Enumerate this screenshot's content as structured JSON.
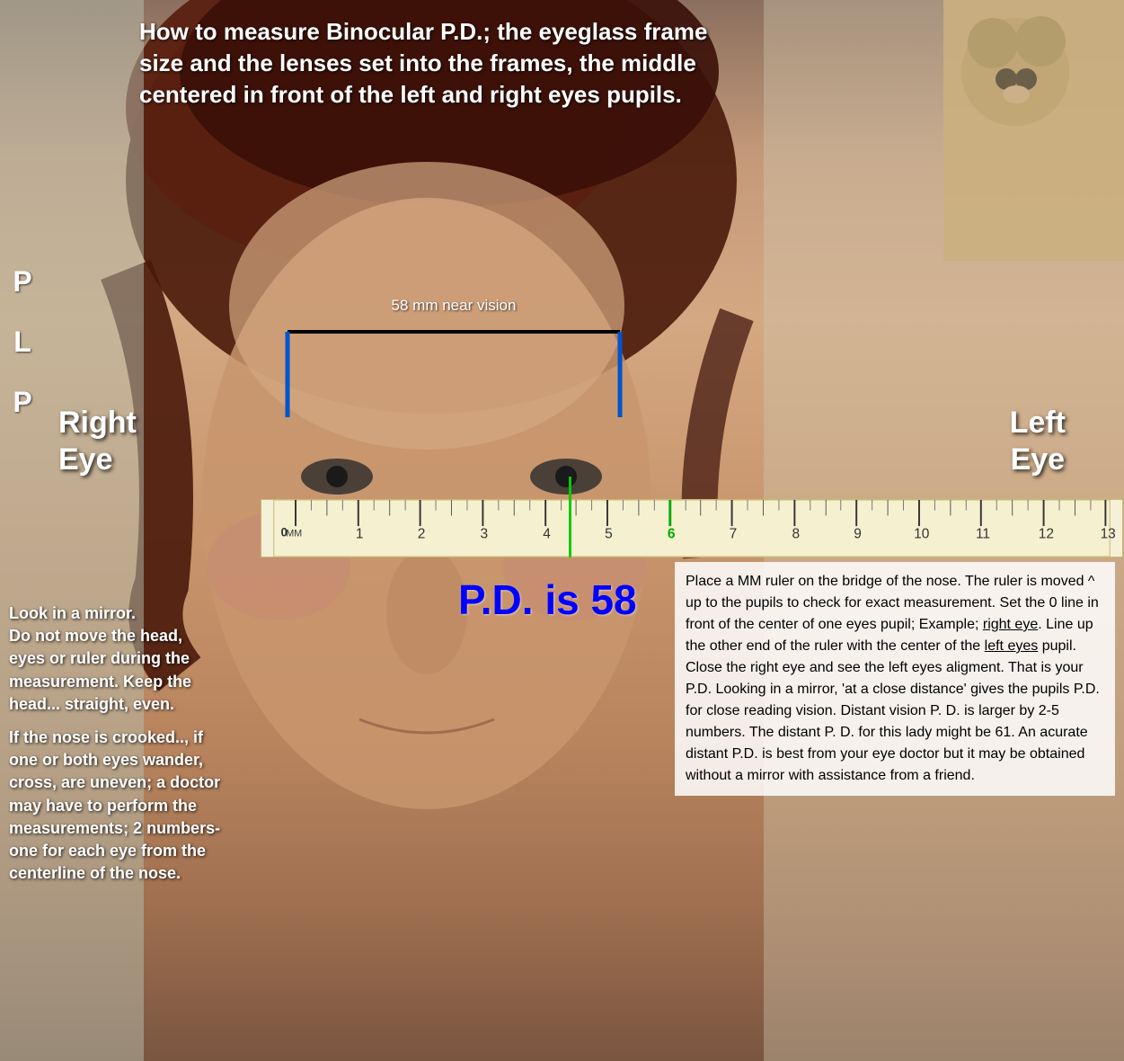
{
  "title": {
    "line1": "How to measure Binocular P.D.; the eyeglass frame",
    "line2": "size and the  lenses set into the frames, the middle",
    "line3": "centered in front of the left and right eyes pupils.",
    "full": "How to measure Binocular P.D.; the eyeglass frame size and the  lenses set into the frames, the middle centered in front of the left and right eyes pupils."
  },
  "labels": {
    "right_eye_line1": "Right",
    "right_eye_line2": "Eye",
    "left_eye_line1": "Left",
    "left_eye_line2": "Eye",
    "near_vision": "58 mm near vision",
    "pd_value": "P.D. is 58"
  },
  "chart_letters": [
    "P",
    "L",
    "P"
  ],
  "left_instructions": {
    "para1": "Look in a mirror.\nDo not move the head,\neyes or ruler during the\nmeasurement. Keep the\nhead... straight, even.",
    "para2": "If the nose is crooked.., if\none or both eyes wander,\ncross, are uneven; a doctor\nmay have to perform the\nmeasurements; 2 numbers-\none for each eye from the\ncenterline of the nose."
  },
  "right_instructions": {
    "text": "Place a MM ruler on the bridge of the nose. The ruler is moved ^ up to the pupils to check for exact measurement. Set the 0 line in front of the center of one eyes pupil; Example; right eye. Line up the other end of the ruler with the center of the left eyes pupil. Close the right eye and see the left eyes aligment. That is your P.D.  Looking in a mirror, 'at a close distance' gives the pupils P.D. for close reading vision. Distant vision P. D. is larger by 2-5 numbers. The distant P. D. for this lady might be 61. An acurate distant P.D. is best from your eye doctor but it may be obtained without a mirror with assistance from a friend.",
    "underline1": "right eye",
    "underline2": "left eyes"
  },
  "ruler": {
    "start": 0,
    "end": 13,
    "unit": "MM"
  }
}
